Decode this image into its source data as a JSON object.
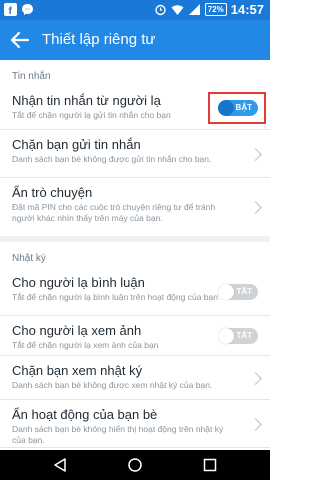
{
  "status_bar": {
    "time": "14:57",
    "battery": "72%"
  },
  "app_bar": {
    "title": "Thiết lập riêng tư"
  },
  "sections": {
    "messages": {
      "header": "Tin nhắn",
      "rows": [
        {
          "title": "Nhận tin nhắn từ người lạ",
          "desc": "Tắt để chặn người lạ gửi tin nhắn cho bạn",
          "toggle": "BẬT"
        },
        {
          "title": "Chặn bạn gửi tin nhắn",
          "desc": "Danh sách bạn bè không được gửi tin nhắn cho bạn."
        },
        {
          "title": "Ẩn trò chuyện",
          "desc": "Đặt mã PIN cho các cuộc trò chuyện riêng tư để tránh người khác nhìn thấy trên máy của bạn."
        }
      ]
    },
    "diary": {
      "header": "Nhật ký",
      "rows": [
        {
          "title": "Cho người lạ bình luận",
          "desc": "Tắt để chặn người lạ bình luận trên hoạt động của bạn",
          "toggle": "TẮT"
        },
        {
          "title": "Cho người lạ xem ảnh",
          "desc": "Tắt để chặn người lạ xem ảnh của bạn",
          "toggle": "TẮT"
        },
        {
          "title": "Chặn bạn xem nhật ký",
          "desc": "Danh sách bạn bè không được xem nhật ký của bạn."
        },
        {
          "title": "Ẩn hoạt động của bạn bè",
          "desc": "Danh sách bạn bè không hiển thị hoạt động trên nhật ký của bạn."
        }
      ]
    }
  },
  "colors": {
    "accent": "#2288e6",
    "status_bar": "#1a78d6",
    "highlight": "#e53935"
  },
  "icons": [
    "facebook-icon",
    "messenger-icon",
    "alarm-icon",
    "wifi-icon",
    "signal-icon",
    "back-arrow-icon"
  ]
}
